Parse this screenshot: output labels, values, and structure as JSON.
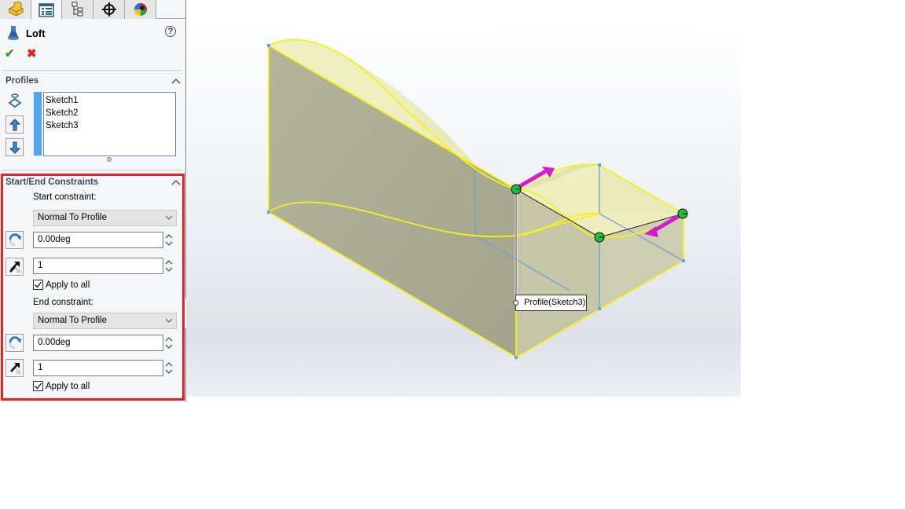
{
  "panel_tabs": [
    {
      "name": "feature-manager",
      "icon": "part-icon"
    },
    {
      "name": "property-manager",
      "icon": "property-manager-icon",
      "active": true
    },
    {
      "name": "configuration-manager",
      "icon": "configuration-icon"
    },
    {
      "name": "dimxpert-manager",
      "icon": "crosshair-icon"
    },
    {
      "name": "display-manager",
      "icon": "appearance-icon"
    }
  ],
  "feature": {
    "title": "Loft",
    "icon": "loft-icon",
    "help_icon": "?",
    "ok_icon": "✔",
    "cancel_icon": "✖"
  },
  "profiles": {
    "title": "Profiles",
    "items": [
      "Sketch1",
      "Sketch2",
      "Sketch3"
    ],
    "buttons": [
      "move-up",
      "move-down"
    ]
  },
  "constraints": {
    "title": "Start/End Constraints",
    "start": {
      "label": "Start constraint:",
      "type": "Normal To Profile",
      "angle": "0.00deg",
      "tangent_length": "1",
      "apply_to_all_label": "Apply to all",
      "apply_to_all": true
    },
    "end": {
      "label": "End constraint:",
      "type": "Normal To Profile",
      "angle": "0.00deg",
      "tangent_length": "1",
      "apply_to_all_label": "Apply to all",
      "apply_to_all": true
    }
  },
  "viewport": {
    "callout": "Profile(Sketch3)",
    "colors": {
      "highlight": "#f2f21a",
      "face": "#b3b399",
      "handle": "#1dbf3a",
      "arrow": "#d21cd2",
      "edge": "#6aa0c8"
    }
  }
}
